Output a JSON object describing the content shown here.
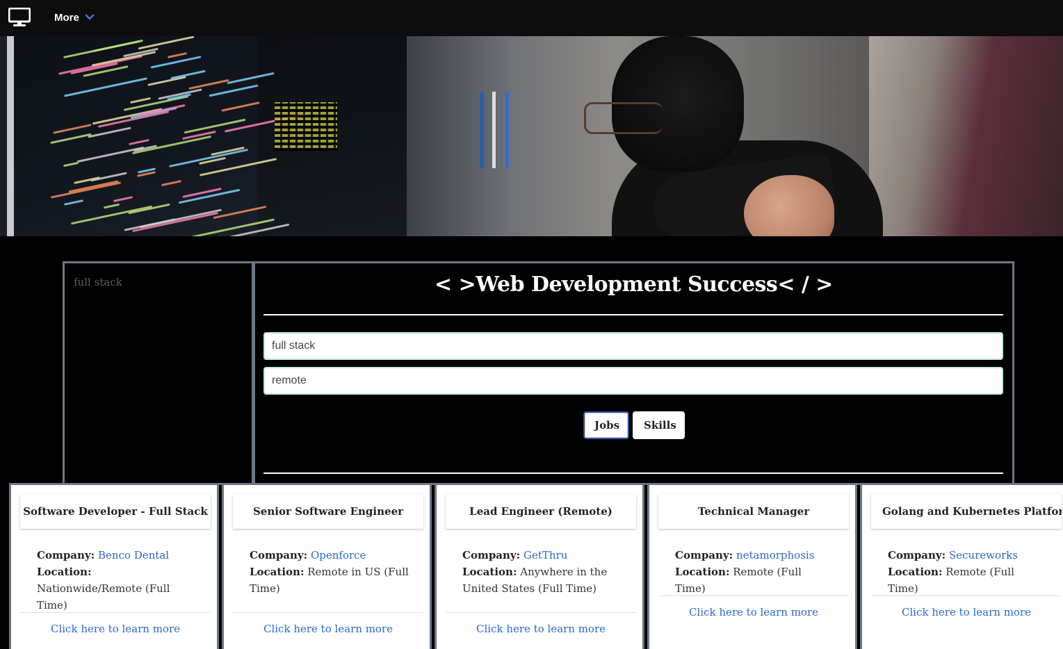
{
  "navbar": {
    "logo_icon": "desktop-monitor-icon",
    "more_label": "More",
    "more_icon": "chevron-down-icon",
    "accent": "#3d7bd9"
  },
  "hero": {
    "alt_icon": "developer-photo"
  },
  "sidebar": {
    "text": "full stack"
  },
  "main": {
    "title": "< >Web Development Success< / >",
    "search_keyword": "full stack",
    "search_location": "remote",
    "jobs_button": "Jobs",
    "skills_button": "Skills"
  },
  "jobs": [
    {
      "title": "Software Developer - Full Stack",
      "company_label": "Company:",
      "company": "Benco Dental",
      "location_label": "Location:",
      "location": "Nationwide/Remote (Full Time)",
      "link": "Click here to learn more"
    },
    {
      "title": "Senior Software Engineer",
      "company_label": "Company:",
      "company": "Openforce",
      "location_label": "Location:",
      "location": "Remote in US (Full Time)",
      "link": "Click here to learn more"
    },
    {
      "title": "Lead Engineer (Remote)",
      "company_label": "Company:",
      "company": "GetThru",
      "location_label": "Location:",
      "location": "Anywhere in the United States (Full Time)",
      "link": "Click here to learn more"
    },
    {
      "title": "Technical Manager",
      "company_label": "Company:",
      "company": "netamorphosis",
      "location_label": "Location:",
      "location": "Remote (Full Time)",
      "link": "Click here to learn more"
    },
    {
      "title": "Golang and Kubernetes Platform Eng",
      "company_label": "Company:",
      "company": "Secureworks",
      "location_label": "Location:",
      "location": "Remote (Full Time)",
      "link": "Click here to learn more"
    }
  ]
}
